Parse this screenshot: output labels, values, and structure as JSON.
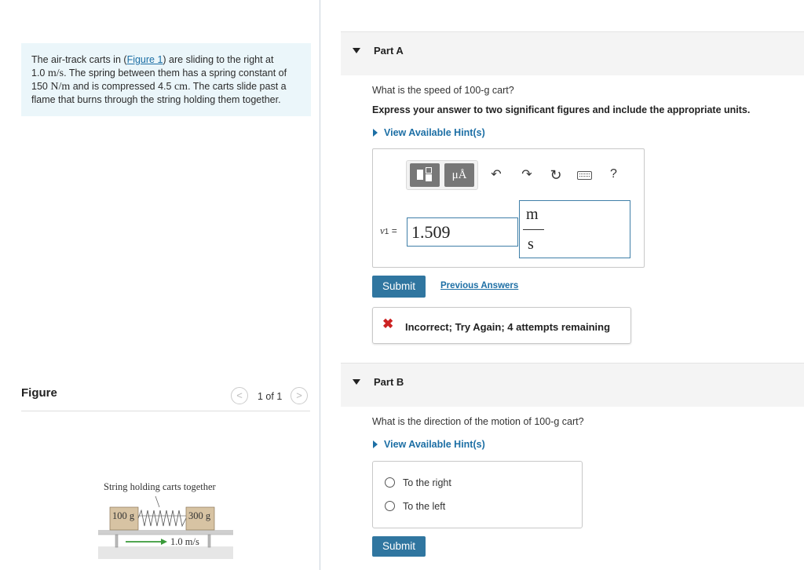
{
  "problem": {
    "text_1": "The air-track carts in (",
    "figure_link": "Figure 1",
    "text_2": ") are sliding to the right at",
    "speed_value": "1.0",
    "speed_unit": "m/s",
    "text_3": ". The spring between them has a spring constant of",
    "k_value": "150",
    "k_unit": "N/m",
    "text_4": " and is compressed 4.5",
    "comp_unit": "cm",
    "text_5": ". The carts slide past a",
    "text_6": "flame that burns through the string holding them together."
  },
  "figure": {
    "title": "Figure",
    "pager": "1 of 1",
    "prev_icon": "chevron-left-icon",
    "next_icon": "chevron-right-icon",
    "string_label": "String holding carts together",
    "cart_left": "100 g",
    "cart_right": "300 g",
    "velocity_label": "1.0 m/s"
  },
  "part_a": {
    "label": "Part A",
    "question": "What is the speed of 100-g cart?",
    "instruction": "Express your answer to two significant figures and include the appropriate units.",
    "hint": "View Available Hint(s)",
    "variable": "v",
    "variable_sub": "1",
    "equals": "=",
    "answer_value": "1.509",
    "unit_num": "m",
    "unit_den": "s",
    "toolbar": {
      "templates_icon": "templates-icon",
      "units_label": "μÅ",
      "undo_icon": "undo-icon",
      "redo_icon": "redo-icon",
      "reset_icon": "reset-icon",
      "keyboard_icon": "keyboard-icon",
      "help_label": "?"
    },
    "submit": "Submit",
    "previous_answers": "Previous Answers",
    "feedback": "Incorrect; Try Again; 4 attempts remaining",
    "feedback_icon": "x-icon",
    "error_color": "#cc2222"
  },
  "part_b": {
    "label": "Part B",
    "question": "What is the direction of the motion of 100-g cart?",
    "hint": "View Available Hint(s)",
    "options": [
      "To the right",
      "To the left"
    ],
    "submit": "Submit"
  },
  "colors": {
    "accent": "#3076a0",
    "link": "#1d6fa5",
    "problem_bg": "#ebf6fa"
  }
}
